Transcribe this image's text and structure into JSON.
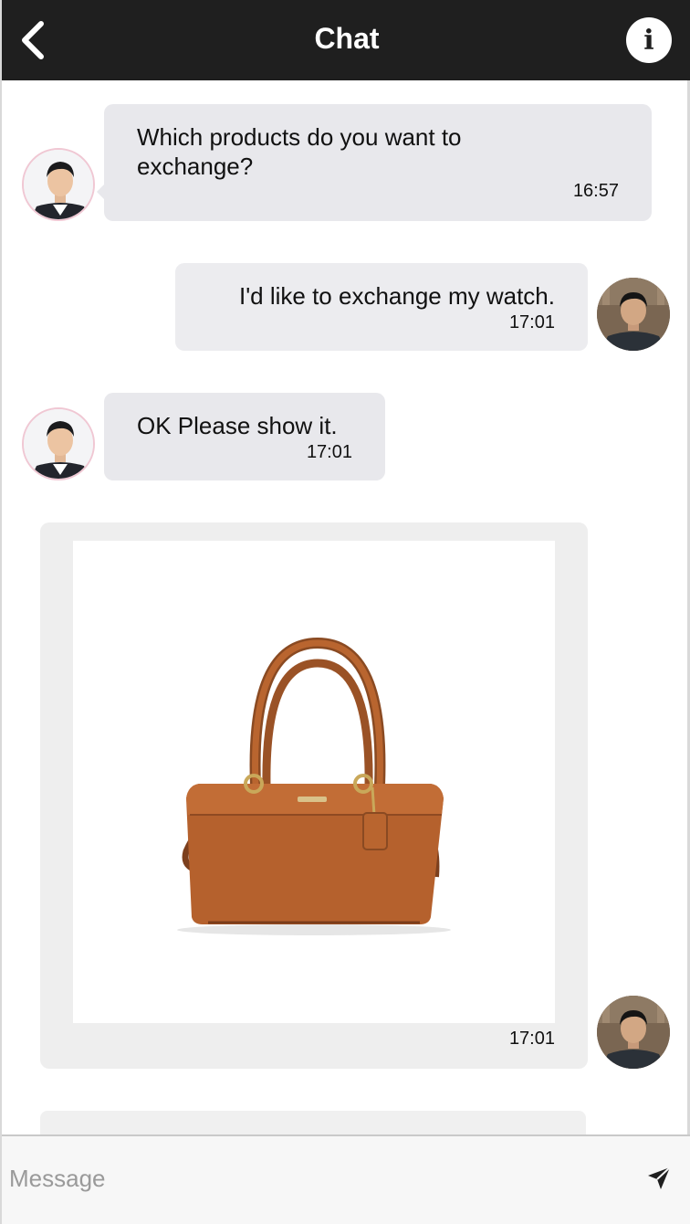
{
  "header": {
    "title": "Chat",
    "back_icon": "chevron-left-icon",
    "info_icon": "info-icon",
    "info_glyph": "i",
    "background": "#1f1f1f"
  },
  "messages": [
    {
      "sender": "agent",
      "text": "Which products do you want to exchange?",
      "time": "16:57"
    },
    {
      "sender": "user",
      "text": "I'd like to exchange my watch.",
      "time": "17:01"
    },
    {
      "sender": "agent",
      "text": "OK Please show it.",
      "time": "17:01"
    },
    {
      "sender": "user",
      "type": "image",
      "image_subject": "tan leather handbag",
      "time": "17:01"
    }
  ],
  "composer": {
    "placeholder": "Message",
    "value": "",
    "send_icon": "send-icon"
  }
}
